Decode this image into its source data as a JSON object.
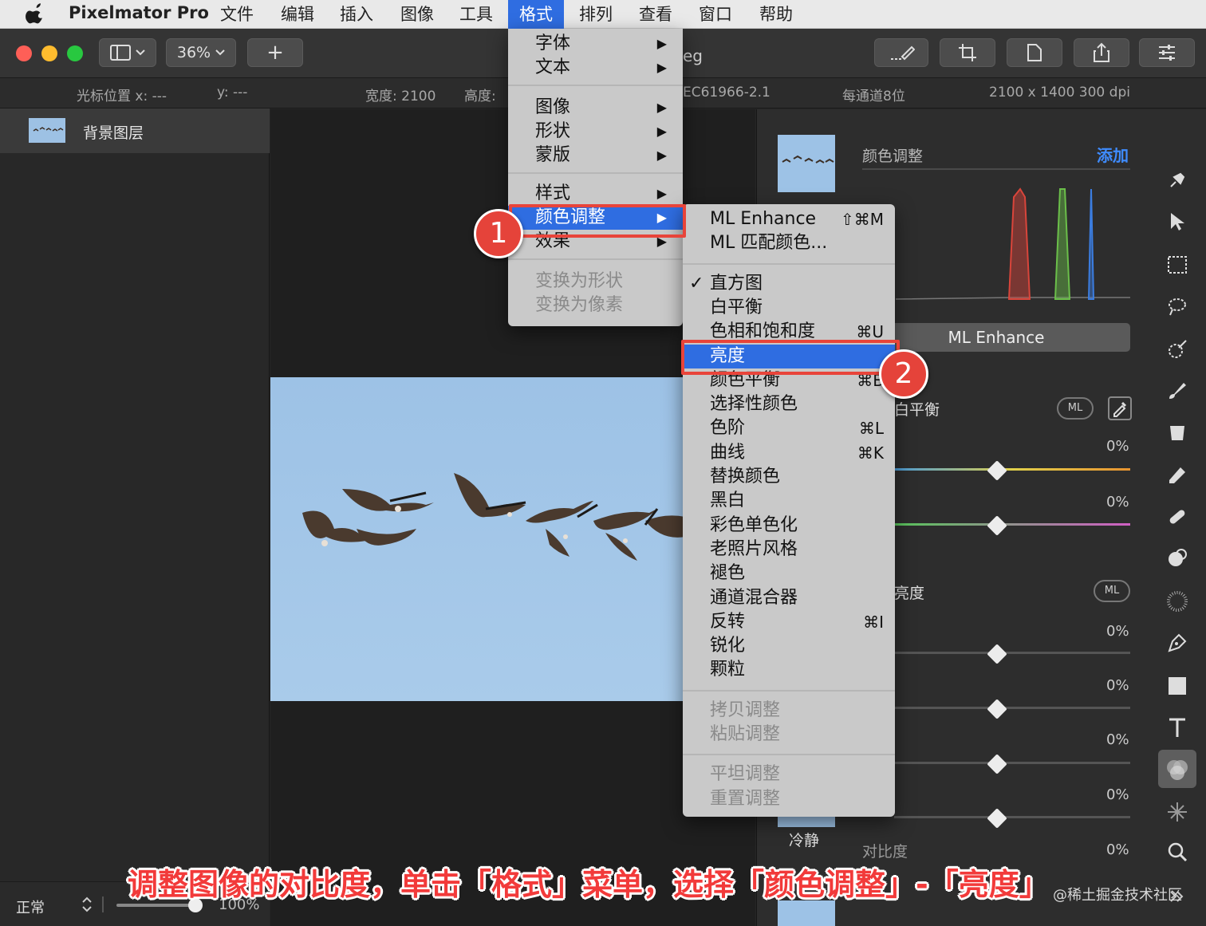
{
  "menubar": {
    "app_name": "Pixelmator Pro",
    "items": [
      "文件",
      "编辑",
      "插入",
      "图像",
      "工具",
      "格式",
      "排列",
      "查看",
      "窗口",
      "帮助"
    ],
    "active": "格式"
  },
  "toolbar": {
    "zoom": "36%",
    "add_symbol": "+",
    "doc_title_fragment": "eg"
  },
  "infobar": {
    "cursor_x": "光标位置 x:  ---",
    "cursor_y": "y:  ---",
    "width": "宽度:  2100",
    "height": "高度:",
    "profile": "EC61966-2.1",
    "bits": "每通道8位",
    "dimensions": "2100 x 1400 300 dpi"
  },
  "layers": {
    "items": [
      {
        "name": "背景图层"
      }
    ],
    "blend_mode": "正常",
    "opacity": "100%"
  },
  "format_menu": {
    "groups": [
      [
        {
          "label": "字体",
          "submenu": true
        },
        {
          "label": "文本",
          "submenu": true
        }
      ],
      [
        {
          "label": "图像",
          "submenu": true
        },
        {
          "label": "形状",
          "submenu": true
        },
        {
          "label": "蒙版",
          "submenu": true
        }
      ],
      [
        {
          "label": "样式",
          "submenu": true
        },
        {
          "label": "颜色调整",
          "submenu": true,
          "highlighted": true
        },
        {
          "label": "效果",
          "submenu": true
        }
      ],
      [
        {
          "label": "变换为形状",
          "disabled": true
        },
        {
          "label": "变换为像素",
          "disabled": true
        }
      ]
    ],
    "arrow_glyph": "▶"
  },
  "color_adjust_menu": {
    "items": [
      {
        "label": "ML Enhance",
        "shortcut": "⇧⌘M"
      },
      {
        "label": "ML 匹配颜色..."
      },
      {
        "sep": true
      },
      {
        "label": "直方图",
        "checked": true
      },
      {
        "label": "白平衡"
      },
      {
        "label": "色相和饱和度",
        "shortcut": "⌘U"
      },
      {
        "label": "亮度",
        "highlighted": true
      },
      {
        "label": "颜色平衡",
        "shortcut": "⌘B"
      },
      {
        "label": "选择性颜色"
      },
      {
        "label": "色阶",
        "shortcut": "⌘L"
      },
      {
        "label": "曲线",
        "shortcut": "⌘K"
      },
      {
        "label": "替换颜色"
      },
      {
        "label": "黑白"
      },
      {
        "label": "彩色单色化"
      },
      {
        "label": "老照片风格"
      },
      {
        "label": "褪色"
      },
      {
        "label": "通道混合器"
      },
      {
        "label": "反转",
        "shortcut": "⌘I"
      },
      {
        "label": "锐化"
      },
      {
        "label": "颗粒"
      },
      {
        "sep": true
      },
      {
        "label": "拷贝调整",
        "disabled": true
      },
      {
        "label": "粘贴调整",
        "disabled": true
      },
      {
        "sep": true
      },
      {
        "label": "平坦调整",
        "disabled": true
      },
      {
        "label": "重置调整",
        "disabled": true
      }
    ],
    "check_glyph": "✓"
  },
  "annotations": {
    "badge1": "1",
    "badge2": "2",
    "caption": "调整图像的对比度，单击「格式」菜单，选择「颜色调整」-「亮度」",
    "watermark": "@稀土掘金技术社区"
  },
  "right_panel": {
    "title": "颜色调整",
    "add": "添加",
    "ml_enhance_button": "ML Enhance",
    "white_balance_label": "白平衡",
    "brightness_label": "亮度",
    "ml_badge": "ML",
    "thumb_label": "冷静",
    "contrast_label": "对比度",
    "slider_values": [
      "0%",
      "0%",
      "0%",
      "0%",
      "0%",
      "0%",
      "0%"
    ],
    "histogram_colors": {
      "red": "#d9453b",
      "green": "#6bbf4a",
      "blue": "#3b7de0"
    }
  },
  "colors": {
    "menu_highlight": "#2f6de1",
    "annotation_red": "#e8443a",
    "sky": "#9dc2e6"
  }
}
